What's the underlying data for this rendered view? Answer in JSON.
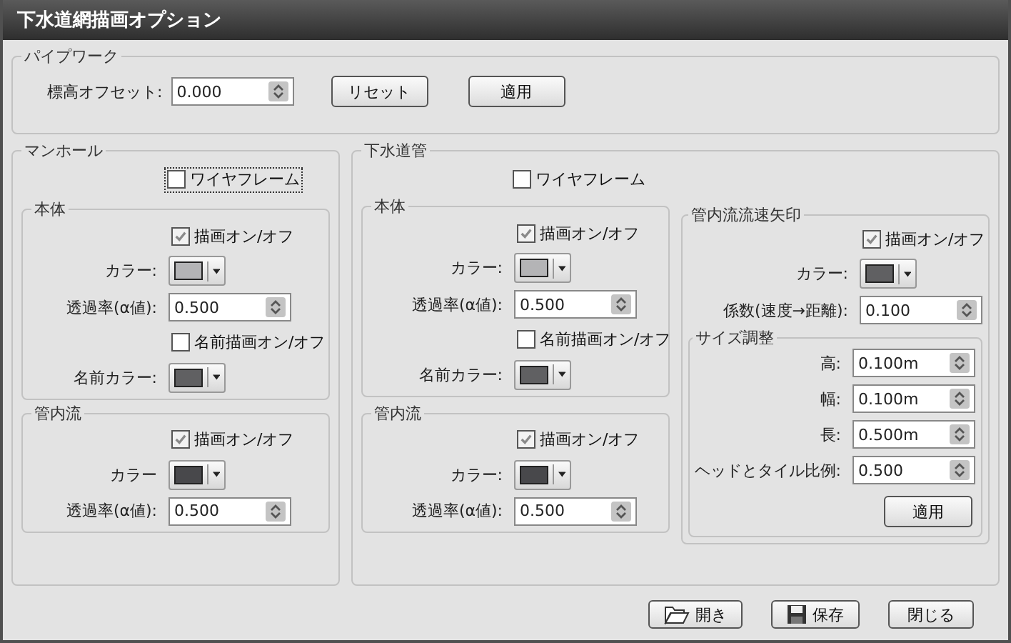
{
  "window": {
    "title": "下水道網描画オプション"
  },
  "pipework": {
    "legend": "パイプワーク",
    "offset_label": "標高オフセット:",
    "offset_value": "0.000",
    "buttons": [
      "リセット",
      "適用"
    ]
  },
  "manhole": {
    "legend": "マンホール",
    "wireframe": {
      "label": "ワイヤフレーム",
      "checked": false,
      "focused": true
    },
    "body": {
      "legend": "本体",
      "draw": {
        "label": "描画オン/オフ",
        "checked": true
      },
      "color": {
        "label": "カラー:",
        "color": "#b4b4b6"
      },
      "alpha": {
        "label": "透過率(α値):",
        "value": "0.500"
      },
      "name_draw": {
        "label": "名前描画オン/オフ",
        "checked": false
      },
      "name_color": {
        "label": "名前カラー:",
        "color": "#606062"
      }
    },
    "flow": {
      "legend": "管内流",
      "draw": {
        "label": "描画オン/オフ",
        "checked": true
      },
      "color": {
        "label": "カラー",
        "color": "#48484b"
      },
      "alpha": {
        "label": "透過率(α値):",
        "value": "0.500"
      }
    }
  },
  "sewer": {
    "legend": "下水道管",
    "wireframe": {
      "label": "ワイヤフレーム",
      "checked": false,
      "focused": false
    },
    "body": {
      "legend": "本体",
      "draw": {
        "label": "描画オン/オフ",
        "checked": true
      },
      "color": {
        "label": "カラー:",
        "color": "#b4b4b6"
      },
      "alpha": {
        "label": "透過率(α値):",
        "value": "0.500"
      },
      "name_draw": {
        "label": "名前描画オン/オフ",
        "checked": false
      },
      "name_color": {
        "label": "名前カラー:",
        "color": "#606062"
      }
    },
    "flow": {
      "legend": "管内流",
      "draw": {
        "label": "描画オン/オフ",
        "checked": true
      },
      "color": {
        "label": "カラー:",
        "color": "#48484b"
      },
      "alpha": {
        "label": "透過率(α値):",
        "value": "0.500"
      }
    },
    "arrow": {
      "legend": "管内流流速矢印",
      "draw": {
        "label": "描画オン/オフ",
        "checked": true
      },
      "color": {
        "label": "カラー:",
        "color": "#606062"
      },
      "coef": {
        "label": "係数(速度→距離):",
        "value": "0.100"
      },
      "size": {
        "legend": "サイズ調整",
        "fields": [
          {
            "label": "高:",
            "value": "0.100m"
          },
          {
            "label": "幅:",
            "value": "0.100m"
          },
          {
            "label": "長:",
            "value": "0.500m"
          },
          {
            "label": "ヘッドとタイル比例:",
            "value": "0.500"
          }
        ],
        "button": "適用"
      }
    }
  },
  "footer": [
    {
      "label": "開き"
    },
    {
      "label": "保存"
    },
    {
      "label": "閉じる"
    }
  ]
}
